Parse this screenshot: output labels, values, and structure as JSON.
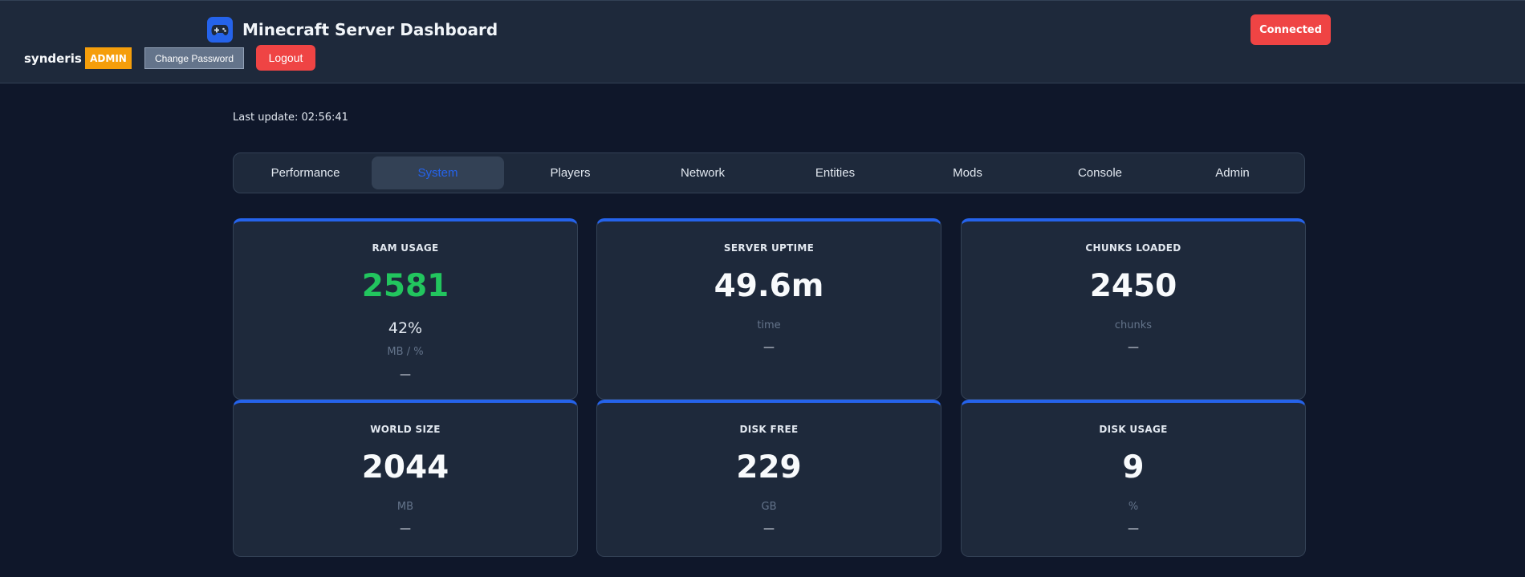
{
  "header": {
    "app_icon": "gamepad-icon",
    "title": "Minecraft Server Dashboard",
    "username": "synderis",
    "role": "ADMIN",
    "change_password_label": "Change Password",
    "logout_label": "Logout",
    "connection_status": "Connected"
  },
  "main": {
    "last_update": "Last update: 02:56:41",
    "tabs": [
      {
        "label": "Performance",
        "active": false
      },
      {
        "label": "System",
        "active": true
      },
      {
        "label": "Players",
        "active": false
      },
      {
        "label": "Network",
        "active": false
      },
      {
        "label": "Entities",
        "active": false
      },
      {
        "label": "Mods",
        "active": false
      },
      {
        "label": "Console",
        "active": false
      },
      {
        "label": "Admin",
        "active": false
      }
    ],
    "cards": [
      {
        "title": "RAM USAGE",
        "value": "2581",
        "percent": "42%",
        "unit": "MB / %",
        "trend": "—"
      },
      {
        "title": "SERVER UPTIME",
        "value": "49.6m",
        "unit": "time",
        "trend": "—"
      },
      {
        "title": "CHUNKS LOADED",
        "value": "2450",
        "unit": "chunks",
        "trend": "—"
      },
      {
        "title": "WORLD SIZE",
        "value": "2044",
        "unit": "MB",
        "trend": "—"
      },
      {
        "title": "DISK FREE",
        "value": "229",
        "unit": "GB",
        "trend": "—"
      },
      {
        "title": "DISK USAGE",
        "value": "9",
        "unit": "%",
        "trend": "—"
      }
    ]
  },
  "colors": {
    "background": "#0f172a",
    "panel": "#1e293b",
    "accent": "#2563eb",
    "danger": "#ef4444",
    "warning": "#f59e0b",
    "success": "#22c55e"
  }
}
